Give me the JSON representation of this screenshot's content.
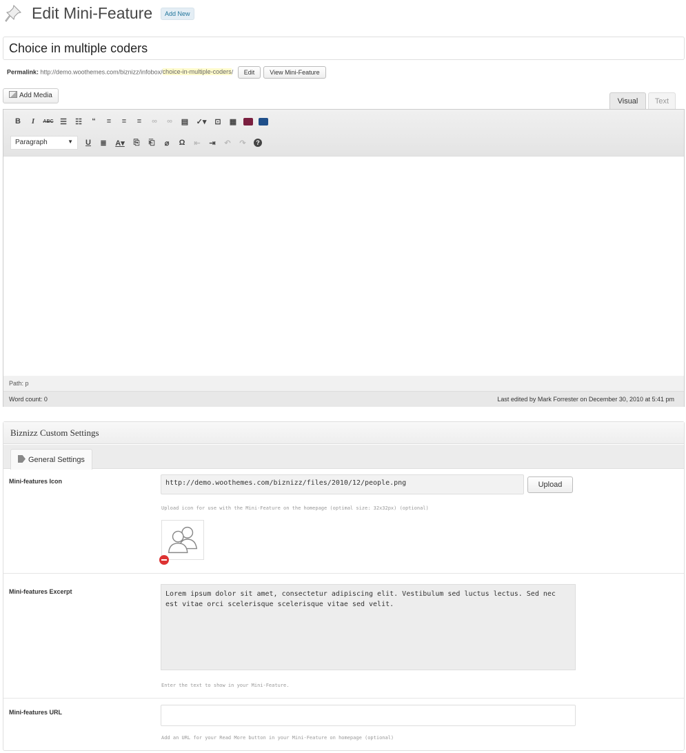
{
  "header": {
    "title": "Edit Mini-Feature",
    "add_new": "Add New"
  },
  "post_title": "Choice in multiple coders",
  "permalink": {
    "label": "Permalink:",
    "base": "http://demo.woothemes.com/biznizz/infobox/",
    "slug": "choice-in-multiple-coders",
    "trail": "/",
    "edit_button": "Edit",
    "view_button": "View Mini-Feature"
  },
  "media": {
    "add_media": "Add Media"
  },
  "editor_tabs": {
    "visual": "Visual",
    "text": "Text"
  },
  "toolbar": {
    "format_select": "Paragraph",
    "row1_icons": [
      "bold-icon",
      "italic-icon",
      "strikethrough-icon",
      "bullet-list-icon",
      "numbered-list-icon",
      "blockquote-icon",
      "align-left-icon",
      "align-center-icon",
      "align-right-icon",
      "link-icon",
      "unlink-icon",
      "more-tag-icon",
      "spellcheck-icon",
      "fullscreen-icon",
      "kitchen-sink-icon",
      "shortcode-icon",
      "shortcode-alt-icon"
    ],
    "row2_icons": [
      "underline-icon",
      "justify-icon",
      "text-color-icon",
      "paste-text-icon",
      "paste-word-icon",
      "clear-format-icon",
      "special-char-icon",
      "outdent-icon",
      "indent-icon",
      "undo-icon",
      "redo-icon",
      "help-icon"
    ]
  },
  "status": {
    "path": "Path: p",
    "word_count": "Word count: 0",
    "last_edited": "Last edited by Mark Forrester on December 30, 2010 at 5:41 pm"
  },
  "custom_settings": {
    "title": "Biznizz Custom Settings",
    "tab": "General Settings",
    "icon_label": "Mini-features Icon",
    "icon_value": "http://demo.woothemes.com/biznizz/files/2010/12/people.png",
    "upload_button": "Upload",
    "icon_desc": "Upload icon for use with the Mini-Feature on the homepage (optimal size: 32x32px) (optional)",
    "excerpt_label": "Mini-features Excerpt",
    "excerpt_value": "Lorem ipsum dolor sit amet, consectetur adipiscing elit. Vestibulum sed luctus lectus. Sed nec est vitae orci scelerisque scelerisque vitae sed velit.",
    "excerpt_desc": "Enter the text to show in your Mini-Feature.",
    "url_label": "Mini-features URL",
    "url_value": "",
    "url_desc": "Add an URL for your Read More button in your Mini-Feature on homepage (optional)"
  }
}
